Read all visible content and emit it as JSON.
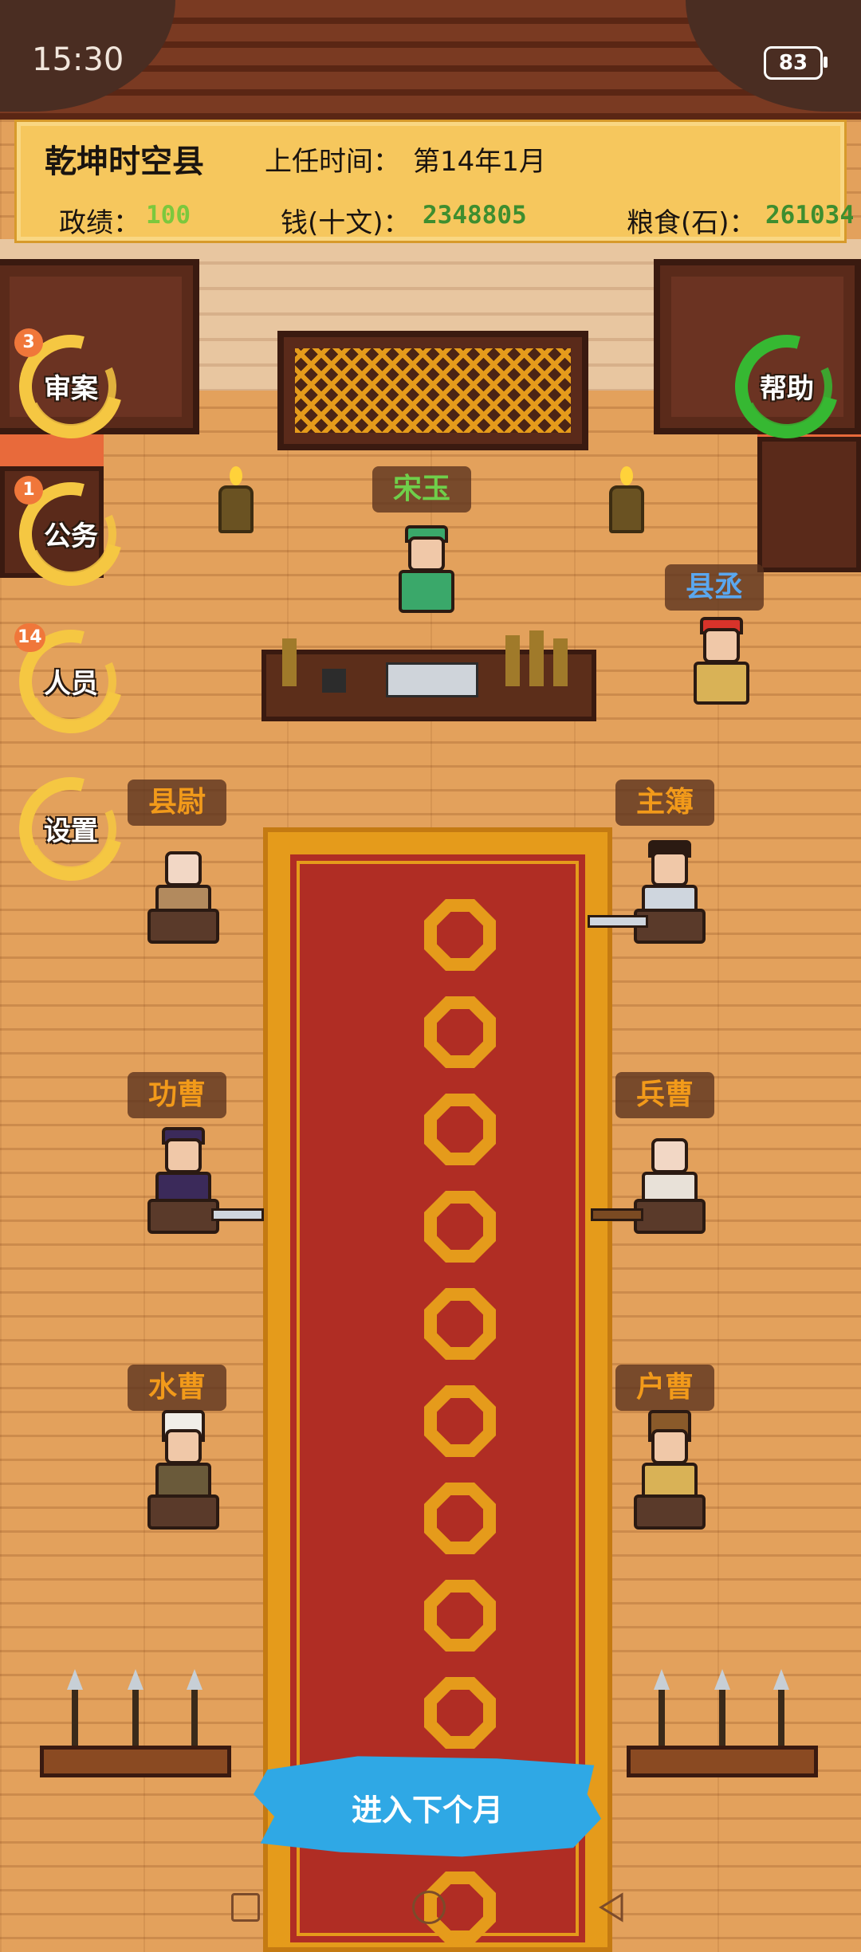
{
  "status_bar": {
    "time": "15:30",
    "battery": "83"
  },
  "info": {
    "county": "乾坤时空县",
    "term_label": "上任时间：",
    "term_value": "第14年1月",
    "stats": [
      {
        "label": "政绩：",
        "value": "100",
        "color": "#7cc83d"
      },
      {
        "label": "钱(十文)：",
        "value": "2348805",
        "color": "#3e8e2f"
      },
      {
        "label": "粮食(石)：",
        "value": "261034",
        "color": "#3e8e2f"
      }
    ]
  },
  "menu": {
    "trial": {
      "label": "审案",
      "badge": "3"
    },
    "affairs": {
      "label": "公务",
      "badge": "1"
    },
    "staff": {
      "label": "人员",
      "badge": "14"
    },
    "settings": {
      "label": "设置"
    },
    "help": {
      "label": "帮助"
    }
  },
  "characters": {
    "magistrate": "宋玉",
    "deputy": "县丞",
    "commandant": "县尉",
    "registrar": "主簿",
    "merit_officer": "功曹",
    "military_officer": "兵曹",
    "water_officer": "水曹",
    "household_officer": "户曹"
  },
  "actions": {
    "next_month": "进入下个月"
  },
  "colors": {
    "panel": "#f6c75d",
    "carpet_red": "#b02d24",
    "carpet_gold": "#e59b1b",
    "floor": "#e3a15c",
    "next_month_button": "#2fa8e5",
    "menu_ring": "#f5c742",
    "help_ring": "#36b832",
    "badge": "#f0773a"
  }
}
